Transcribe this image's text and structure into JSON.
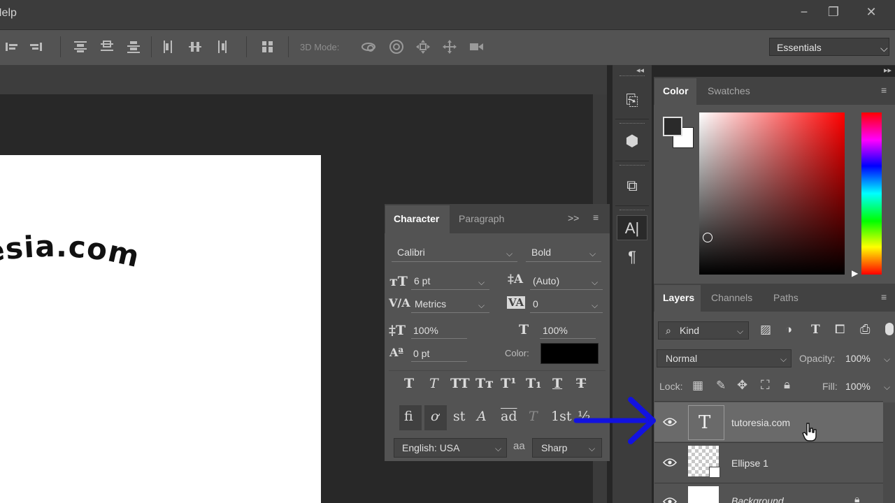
{
  "menu": {
    "help_label": "Help"
  },
  "window": {
    "minimize": "−",
    "restore": "❐",
    "close": "✕"
  },
  "options_bar": {
    "mode_3d_label": "3D Mode:",
    "workspace": "Essentials"
  },
  "canvas": {
    "document_text": "tutoresia.com"
  },
  "character_panel": {
    "tabs": [
      "Character",
      "Paragraph"
    ],
    "font_family": "Calibri",
    "font_style": "Bold",
    "font_size": "6 pt",
    "leading": "(Auto)",
    "kerning": "Metrics",
    "tracking": "0",
    "vertical_scale": "100%",
    "horizontal_scale": "100%",
    "baseline_shift": "0 pt",
    "color_label": "Color:",
    "color_value": "#000000",
    "language": "English: USA",
    "antialias_glyph": "aa",
    "antialias": "Sharp",
    "style_buttons": [
      "T",
      "T",
      "TT",
      "Tт",
      "T¹",
      "T₁",
      "T",
      "T"
    ],
    "opentype_buttons": [
      "fi",
      "ơ",
      "st",
      "A",
      "ad",
      "T",
      "1st",
      "½"
    ]
  },
  "color_panel": {
    "tabs": [
      "Color",
      "Swatches"
    ]
  },
  "layers_panel": {
    "tabs": [
      "Layers",
      "Channels",
      "Paths"
    ],
    "filter_kind": "Kind",
    "blend_mode": "Normal",
    "opacity_label": "Opacity:",
    "opacity_value": "100%",
    "lock_label": "Lock:",
    "fill_label": "Fill:",
    "fill_value": "100%",
    "layers": [
      {
        "name": "tutoresia.com",
        "type": "text"
      },
      {
        "name": "Ellipse 1",
        "type": "shape"
      },
      {
        "name": "Background",
        "type": "background"
      }
    ]
  },
  "accent": {
    "arrow": "#1212e0",
    "selected_row": "#6a6a6a"
  }
}
